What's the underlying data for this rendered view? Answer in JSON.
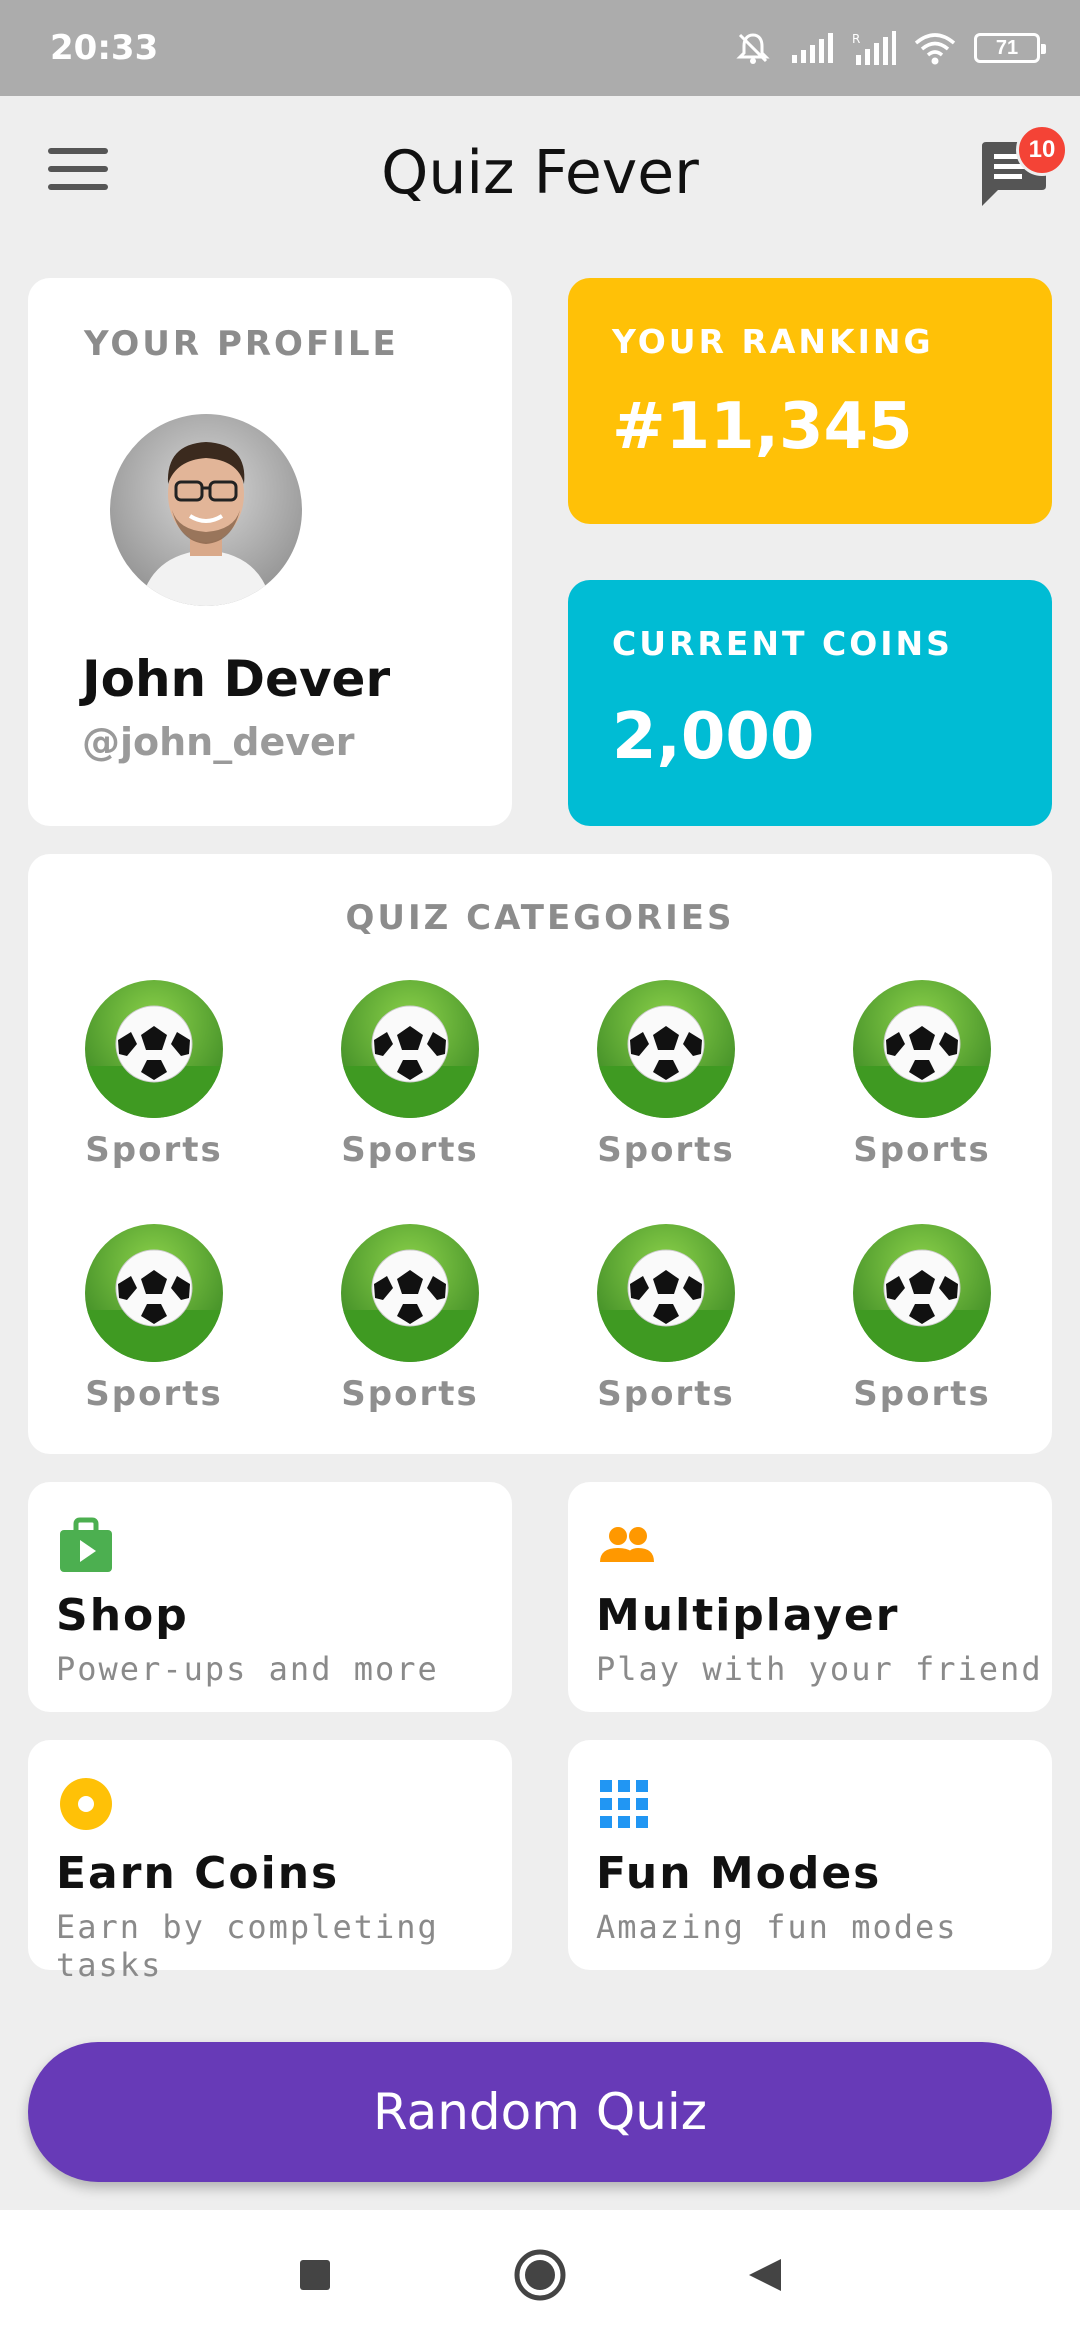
{
  "status_bar": {
    "time": "20:33",
    "battery": "71"
  },
  "header": {
    "title": "Quiz Fever",
    "notification_count": "10"
  },
  "profile": {
    "label": "YOUR PROFILE",
    "name": "John Dever",
    "handle": "@john_dever"
  },
  "ranking": {
    "label": "YOUR RANKING",
    "value": "#11,345",
    "color": "#ffc107"
  },
  "coins": {
    "label": "CURRENT COINS",
    "value": "2,000",
    "color": "#00bcd4"
  },
  "categories": {
    "title": "QUIZ CATEGORIES",
    "items": [
      {
        "label": "Sports",
        "icon": "soccer-ball-icon"
      },
      {
        "label": "Sports",
        "icon": "soccer-ball-icon"
      },
      {
        "label": "Sports",
        "icon": "soccer-ball-icon"
      },
      {
        "label": "Sports",
        "icon": "soccer-ball-icon"
      },
      {
        "label": "Sports",
        "icon": "soccer-ball-icon"
      },
      {
        "label": "Sports",
        "icon": "soccer-ball-icon"
      },
      {
        "label": "Sports",
        "icon": "soccer-ball-icon"
      },
      {
        "label": "Sports",
        "icon": "soccer-ball-icon"
      }
    ]
  },
  "menu": {
    "shop": {
      "title": "Shop",
      "subtitle": "Power-ups and more",
      "icon": "shop-bag-icon",
      "color": "#4caf50"
    },
    "multiplayer": {
      "title": "Multiplayer",
      "subtitle": "Play with your friend",
      "icon": "people-icon",
      "color": "#ff9800"
    },
    "earn_coins": {
      "title": "Earn Coins",
      "subtitle": "Earn by completing tasks",
      "icon": "coin-icon",
      "color": "#ffc107"
    },
    "fun_modes": {
      "title": "Fun Modes",
      "subtitle": "Amazing fun modes",
      "icon": "grid-icon",
      "color": "#2196f3"
    }
  },
  "random_quiz": {
    "label": "Random Quiz",
    "color": "#673ab7"
  }
}
